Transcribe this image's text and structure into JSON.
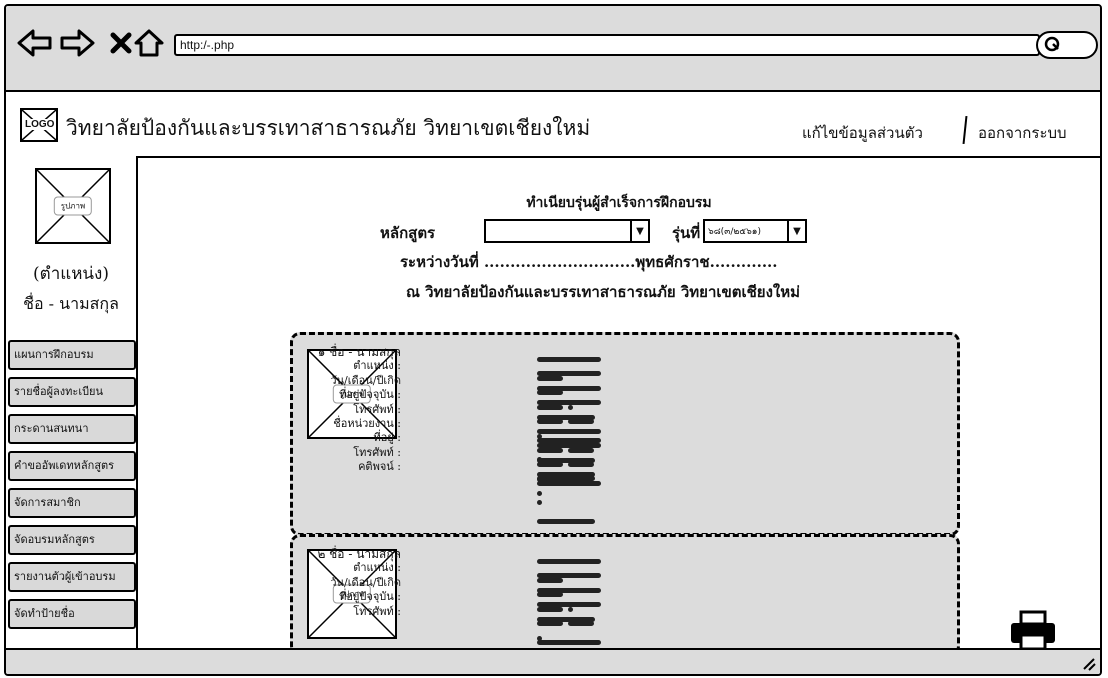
{
  "browser": {
    "url": "http:/-.php",
    "icons": [
      "back-arrow-icon",
      "forward-arrow-icon",
      "close-icon",
      "home-icon",
      "search-icon"
    ]
  },
  "header": {
    "logo_text": "LOGO",
    "title": "วิทยาลัยป้องกันและบรรเทาสาธารณภัย วิทยาเขตเชียงใหม่",
    "edit_profile_link": "แก้ไขข้อมูลส่วนตัว",
    "logout_link": "ออกจากระบบ"
  },
  "sidebar": {
    "image_label": "รูปภาพ",
    "position": "(ตำแหน่ง)",
    "name": "ชื่อ - นามสกุล",
    "menu": [
      "แผนการฝึกอบรม",
      "รายชื่อผู้ลงทะเบียน",
      "กระดานสนทนา",
      "คำขออัพเดทหลักสูตร",
      "จัดการสมาชิก",
      "จัดอบรมหลักสูตร",
      "รายงานตัวผู้เข้าอบรม",
      "จัดทำป้ายชื่อ"
    ]
  },
  "report": {
    "title": "ทำเนียบรุ่นผู้สำเร็จการฝึกอบรม",
    "course_label": "หลักสูตร",
    "course_value": "",
    "batch_label": "รุ่นที่",
    "batch_value": "๖๘(๓/๒๕๖๑)",
    "between_line": "ระหว่างวันที่ .............................พุทธศักราช.............",
    "at_line": "ณ วิทยาลัยป้องกันและบรรเทาสาธารณภัย วิทยาเขตเชียงใหม่"
  },
  "members": [
    {
      "image_label": "รูปภาพ",
      "fields": [
        "๑ ชื่อ - นามสกุล",
        "ตำแหน่ง :",
        "วัน/เดือน/ปีเกิด",
        "ที่อยู่ปัจจุบัน :",
        "โทรศัพท์ :",
        "ชื่อหน่วยงาน :",
        "ที่อยู่ :",
        "โทรศัพท์ :",
        "คติพจน์ :"
      ]
    },
    {
      "image_label": "รูปภาพ",
      "fields": [
        "๒ ชื่อ - นามสกุล",
        "ตำแหน่ง :",
        "วัน/เดือน/ปีเกิด",
        "ที่อยู่ปัจจุบัน :",
        "โทรศัพท์ :"
      ]
    }
  ],
  "icons": {
    "print": "printer-icon",
    "resize": "resize-handle-icon"
  }
}
